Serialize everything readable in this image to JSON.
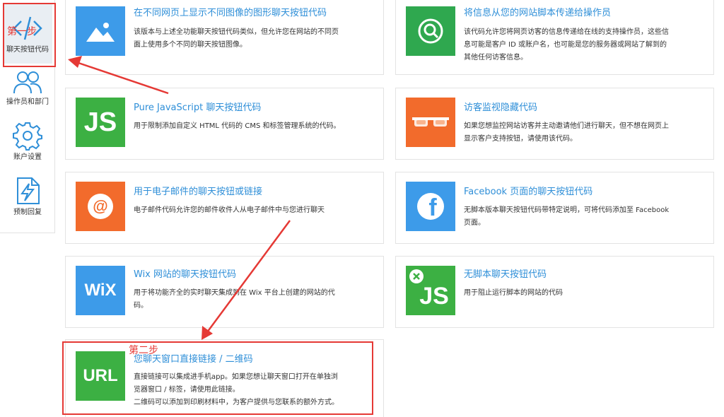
{
  "sidebar": {
    "items": [
      {
        "label": "聊天按钮代码",
        "icon": "code-icon",
        "active": true
      },
      {
        "label": "操作员和部门",
        "icon": "users-icon"
      },
      {
        "label": "账户设置",
        "icon": "gear-icon"
      },
      {
        "label": "预制回复",
        "icon": "canned-reply-icon"
      }
    ]
  },
  "cards": [
    {
      "title": "在不同网页上显示不同图像的图形聊天按钮代码",
      "desc": [
        "该版本与上述全功能聊天按钮代码类似，但允许您在网站的不同页",
        "面上使用多个不同的聊天按钮图像。"
      ],
      "icon": "image-icon",
      "color": "#3d9be9"
    },
    {
      "title": "将信息从您的网站脚本传递给操作员",
      "desc": [
        "该代码允许您将网页访客的信息传递给在线的支持操作员，这些信",
        "息可能是客户 ID 或账户名，也可能是您的服务器或网站了解到的",
        "其他任何访客信息。"
      ],
      "icon": "search-icon",
      "color": "#2fa84f"
    },
    {
      "title": "Pure JavaScript 聊天按钮代码",
      "desc": [
        "用于限制添加自定义 HTML 代码的 CMS 和标签管理系统的代码。"
      ],
      "icon": "js-icon",
      "tile_text": "JS",
      "color": "#3cb043"
    },
    {
      "title": "访客监视隐藏代码",
      "desc": [
        "如果您想监控网站访客并主动邀请他们进行聊天，但不想在网页上",
        "显示客户支持按钮，请使用该代码。"
      ],
      "icon": "glasses-icon",
      "color": "#f26b2c"
    },
    {
      "title": "用于电子邮件的聊天按钮或链接",
      "desc": [
        "电子邮件代码允许您的邮件收件人从电子邮件中与您进行聊天"
      ],
      "icon": "at-icon",
      "tile_text": "@",
      "color": "#f26b2c"
    },
    {
      "title": "Facebook 页面的聊天按钮代码",
      "desc": [
        "无脚本版本聊天按钮代码带特定说明，可将代码添加至 Facebook",
        "页面。"
      ],
      "icon": "facebook-icon",
      "tile_text": "f",
      "color": "#3d9be9"
    },
    {
      "title": "Wix 网站的聊天按钮代码",
      "desc": [
        "用于将功能齐全的实时聊天集成到在 Wix 平台上创建的网站的代",
        "码。"
      ],
      "icon": "wix-icon",
      "tile_text": "WiX",
      "color": "#3d9be9"
    },
    {
      "title": "无脚本聊天按钮代码",
      "desc": [
        "用于阻止运行脚本的网站的代码"
      ],
      "icon": "no-js-icon",
      "tile_text": "JS",
      "color": "#3cb043"
    },
    {
      "title": "您聊天窗口直接链接 / 二维码",
      "desc": [
        "直接链接可以集成进手机app。如果您想让聊天窗口打开在单独浏",
        "览器窗口 / 标签，请使用此链接。",
        "二维码可以添加到印刷材料中，为客户提供与您联系的额外方式。"
      ],
      "icon": "url-icon",
      "tile_text": "URL",
      "color": "#3cb043"
    }
  ],
  "annotations": {
    "step1": "第一步",
    "step2": "第二步",
    "accent": "#e53935"
  }
}
